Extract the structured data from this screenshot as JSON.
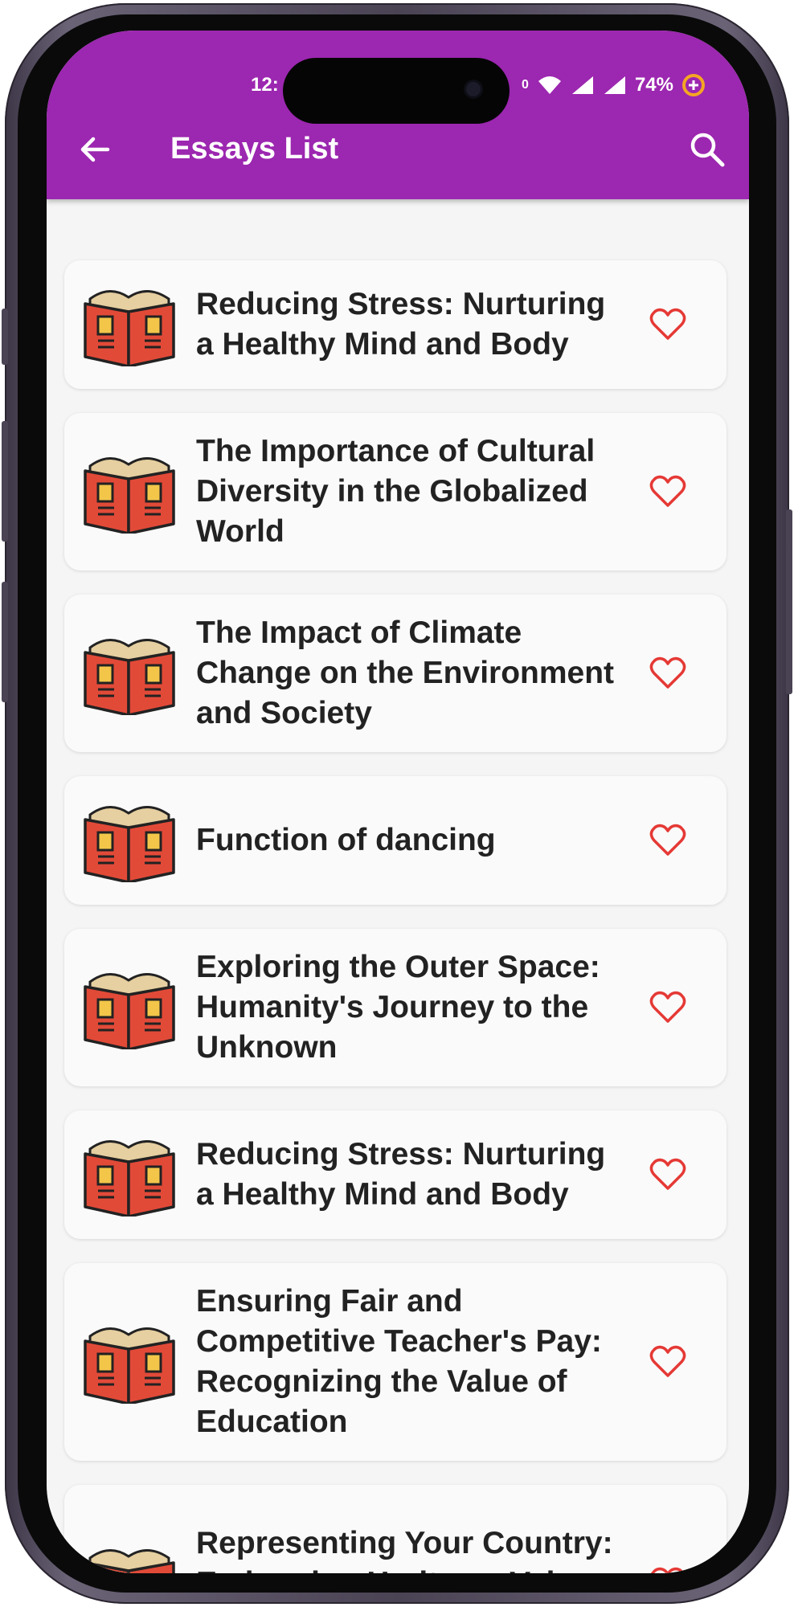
{
  "status_bar": {
    "time": "12:",
    "network_speed": "0",
    "battery": "74%"
  },
  "toolbar": {
    "title": "Essays List",
    "back_icon": "arrow-left-icon",
    "search_icon": "search-icon"
  },
  "colors": {
    "app_bar": "#9c27b0",
    "heart": "#e53935",
    "book_red": "#e24a38",
    "book_yellow": "#f3c64a"
  },
  "essays": [
    {
      "title": "Reducing Stress: Nurturing a Healthy Mind and Body"
    },
    {
      "title": "The Importance of Cultural Diversity in the Globalized World"
    },
    {
      "title": "The Impact of Climate Change on the Environment and Society"
    },
    {
      "title": "Function of dancing"
    },
    {
      "title": "Exploring the Outer Space: Humanity's Journey to the Unknown"
    },
    {
      "title": "Reducing Stress: Nurturing a Healthy Mind and Body"
    },
    {
      "title": "Ensuring Fair and Competitive Teacher's Pay: Recognizing the Value of Education"
    },
    {
      "title": "Representing Your Country: Embracing Heritage, Values, and"
    }
  ]
}
